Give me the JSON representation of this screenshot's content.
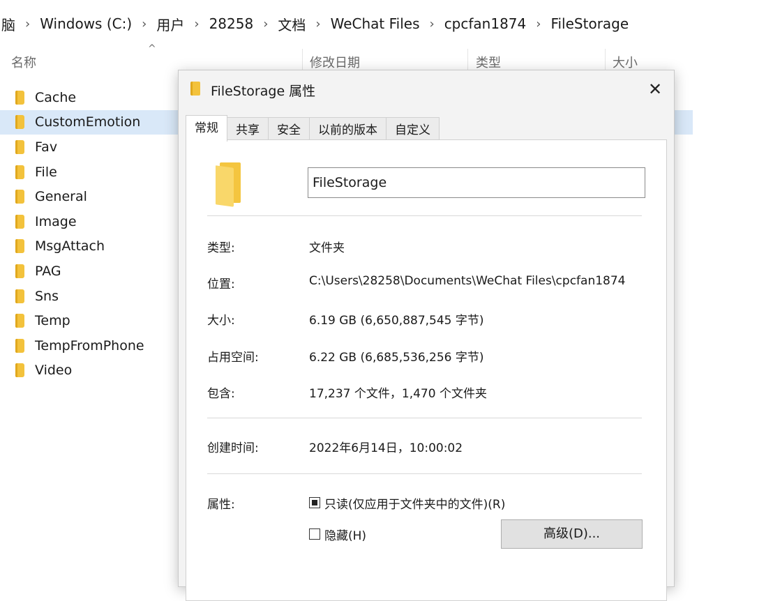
{
  "breadcrumb": [
    "脑",
    "Windows (C:)",
    "用户",
    "28258",
    "文档",
    "WeChat Files",
    "cpcfan1874",
    "FileStorage"
  ],
  "columns": {
    "name": "名称",
    "modified": "修改日期",
    "type": "类型",
    "size": "大小"
  },
  "files": [
    "Cache",
    "CustomEmotion",
    "Fav",
    "File",
    "General",
    "Image",
    "MsgAttach",
    "PAG",
    "Sns",
    "Temp",
    "TempFromPhone",
    "Video"
  ],
  "selected_file": "CustomEmotion",
  "dialog": {
    "title": "FileStorage 属性",
    "tabs": [
      "常规",
      "共享",
      "安全",
      "以前的版本",
      "自定义"
    ],
    "active_tab": "常规",
    "folder_name": "FileStorage",
    "props": {
      "type_label": "类型:",
      "type_value": "文件夹",
      "location_label": "位置:",
      "location_value": "C:\\Users\\28258\\Documents\\WeChat Files\\cpcfan1874",
      "size_label": "大小:",
      "size_value": "6.19 GB (6,650,887,545 字节)",
      "disk_label": "占用空间:",
      "disk_value": "6.22 GB (6,685,536,256 字节)",
      "contains_label": "包含:",
      "contains_value": "17,237 个文件，1,470 个文件夹",
      "created_label": "创建时间:",
      "created_value": "2022年6月14日，10:00:02",
      "attrs_label": "属性:"
    },
    "readonly_label": "只读(仅应用于文件夹中的文件)(R)",
    "readonly_state": "mixed",
    "hidden_label": "隐藏(H)",
    "hidden_checked": false,
    "advanced_button": "高级(D)..."
  },
  "colors": {
    "selection": "#d9e8f8",
    "folder": "#f3c23c"
  }
}
